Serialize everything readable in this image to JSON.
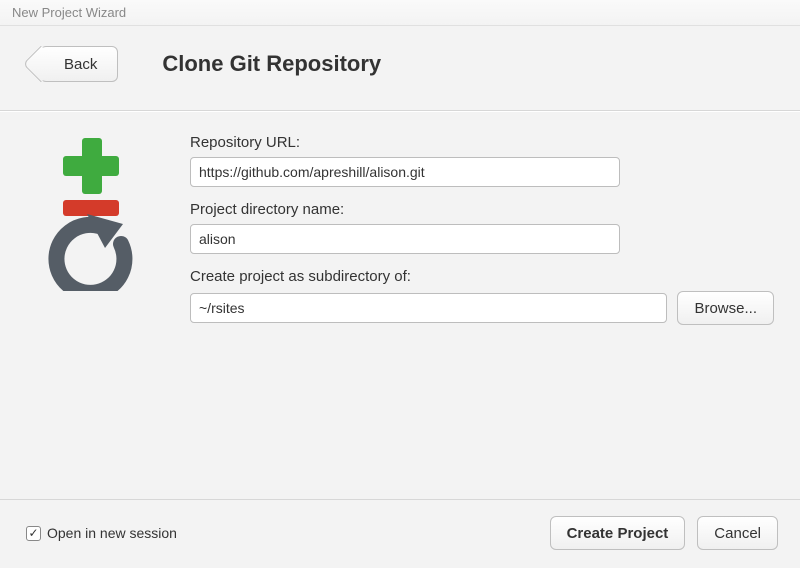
{
  "window": {
    "title": "New Project Wizard"
  },
  "header": {
    "back_label": "Back",
    "page_title": "Clone Git Repository"
  },
  "form": {
    "repo_url_label": "Repository URL:",
    "repo_url_value": "https://github.com/apreshill/alison.git",
    "dir_name_label": "Project directory name:",
    "dir_name_value": "alison",
    "subdir_label": "Create project as subdirectory of:",
    "subdir_value": "~/rsites",
    "browse_label": "Browse..."
  },
  "footer": {
    "open_new_session_label": "Open in new session",
    "open_new_session_checked": true,
    "checkmark": "✓",
    "create_label": "Create Project",
    "cancel_label": "Cancel"
  }
}
